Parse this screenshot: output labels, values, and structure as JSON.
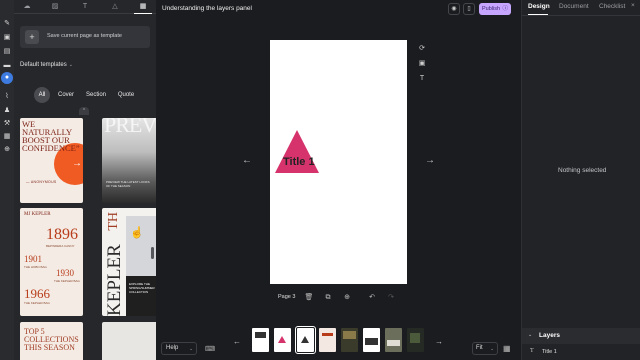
{
  "doc_title": "Understanding the layers panel",
  "rail_icons": [
    "pin-icon",
    "layers-icon",
    "folder-icon",
    "comment-icon",
    "help-circle-icon",
    "brush-icon",
    "user-icon",
    "wrench-icon",
    "layout-icon",
    "plus-circle-icon"
  ],
  "left_tabs": [
    "cloud-icon",
    "image-icon",
    "text-icon",
    "shapes-icon",
    "templates-icon"
  ],
  "save_template_label": "Save current page as template",
  "default_templates_label": "Default templates",
  "filters": [
    "All",
    "Cover",
    "Section",
    "Quote"
  ],
  "selected_filter": "All",
  "templates": {
    "t1": {
      "heading": "WE NATURALLY BOOST OUR CONFIDENCE”",
      "author": "— ANONYMOUS"
    },
    "t2": {
      "big": "PREVIEW",
      "small": "PREVIEW THE LATEST LOOKS OF THE SEASON"
    },
    "t3": {
      "name": "MJ KEPLER",
      "y1": "1896",
      "c1": "BEPINDERA CANNY",
      "y2": "1901",
      "c2": "THE HOBO BAG",
      "y3": "1930",
      "c3": "THE KEPLER BAG",
      "y4": "1966",
      "c4": "THE KEPLER BAG"
    },
    "t4": {
      "th": "TH",
      "kepler": "KEPLER",
      "dark_text": "EXPLORE THE SPRING/SUMMER COLLECTION"
    },
    "t5": {
      "heading": "TOP 5 COLLECTIONS THIS SEASON"
    }
  },
  "publish_label": "Publish",
  "canvas_text": "Title 1",
  "page_label": "Page 3",
  "help_label": "Help",
  "fit_label": "Fit",
  "right_tabs": [
    "Design",
    "Document",
    "Checklist"
  ],
  "active_right_tab": "Design",
  "nothing_selected": "Nothing selected",
  "layers_title": "Layers",
  "layer_items": [
    {
      "icon": "text-layer-icon",
      "name": "Title 1"
    }
  ],
  "colors": {
    "accent": "#3d7be0",
    "publish": "#c7a6ff",
    "triangle": "#d6336c",
    "panel": "#26272b",
    "canvas_bg": "#1b1c1f"
  }
}
